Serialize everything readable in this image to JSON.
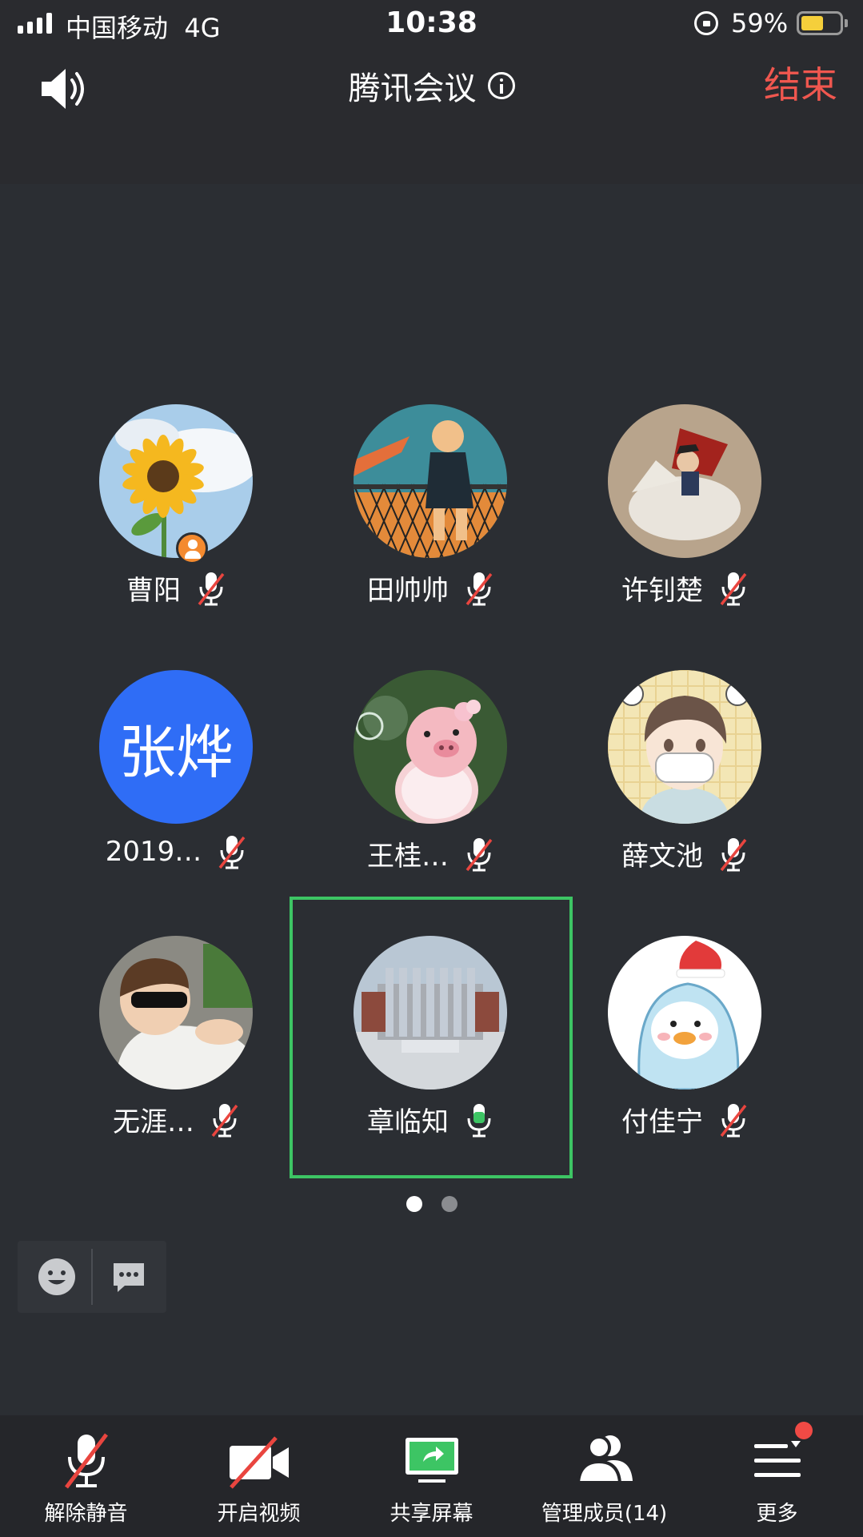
{
  "status_bar": {
    "carrier": "中国移动",
    "network": "4G",
    "time": "10:38",
    "battery_percent": "59%",
    "battery_level": 0.59
  },
  "header": {
    "title": "腾讯会议",
    "end_label": "结束",
    "end_color": "#f0574f"
  },
  "participants": [
    {
      "name": "曹阳",
      "muted": true,
      "host": true,
      "avatar": "sunflower-sky"
    },
    {
      "name": "田帅帅",
      "muted": true,
      "avatar": "anime-fence"
    },
    {
      "name": "许钊楚",
      "muted": true,
      "avatar": "napoleon-horse"
    },
    {
      "name": "2019…",
      "muted": true,
      "avatar_text": "张烨",
      "avatar_color": "#2f6df6"
    },
    {
      "name": "王桂…",
      "muted": true,
      "avatar": "pig-bubbles"
    },
    {
      "name": "薛文池",
      "muted": true,
      "avatar": "anime-boy-mask"
    },
    {
      "name": "无涯…",
      "muted": true,
      "avatar": "kid-sunglasses"
    },
    {
      "name": "章临知",
      "muted": false,
      "speaking": true,
      "avatar": "building"
    },
    {
      "name": "付佳宁",
      "muted": true,
      "avatar": "shark-bird"
    }
  ],
  "pagination": {
    "pages": 2,
    "current": 1
  },
  "toolbar": {
    "unmute": "解除静音",
    "video": "开启视频",
    "share": "共享屏幕",
    "members": "管理成员(14)",
    "more": "更多"
  },
  "colors": {
    "accent_green": "#3dc564",
    "muted_red": "#e9453f",
    "background": "#2b2e33"
  }
}
